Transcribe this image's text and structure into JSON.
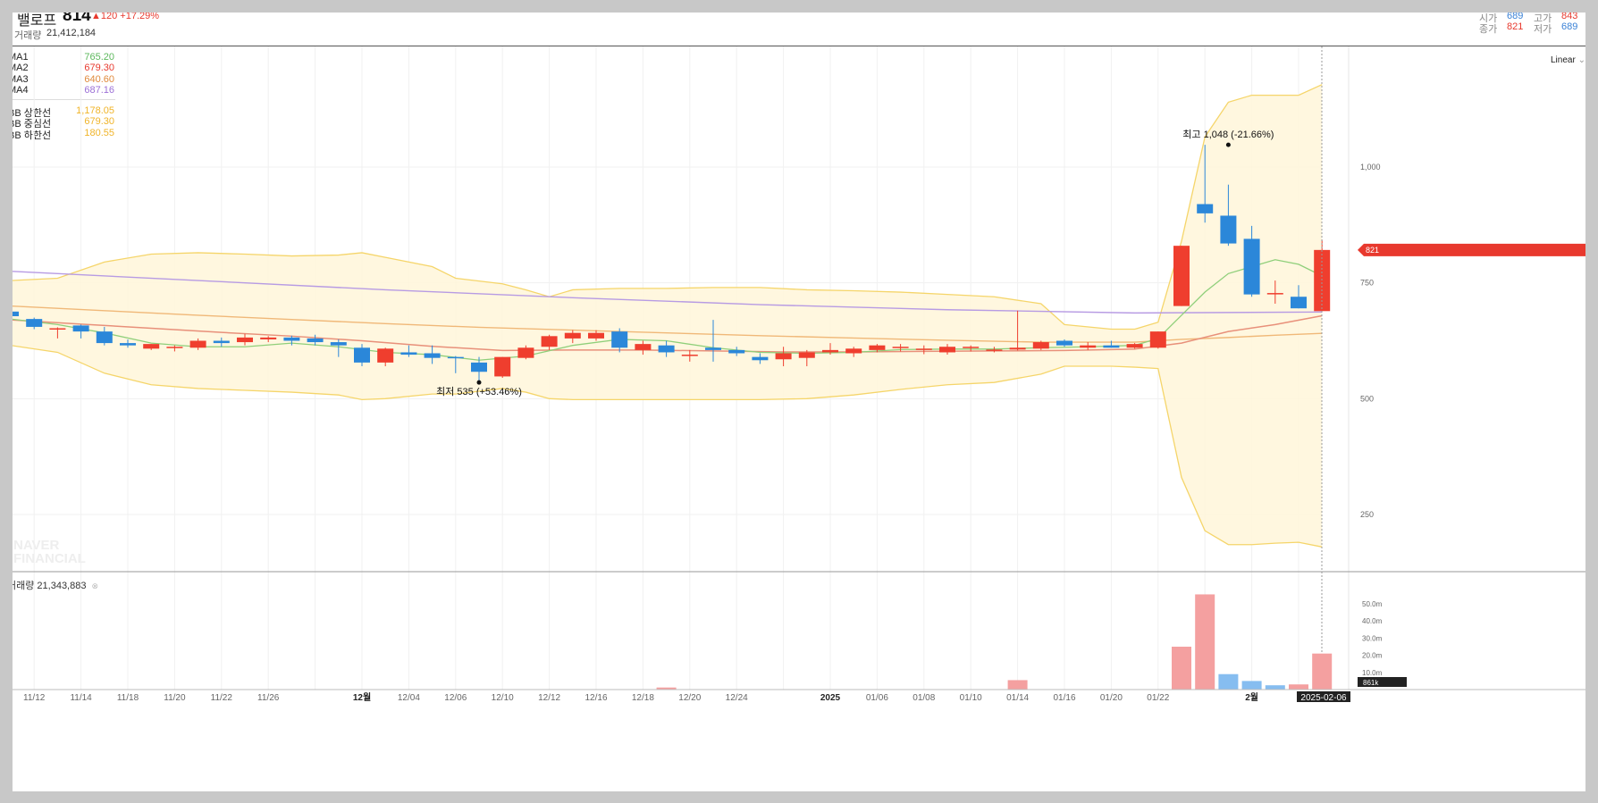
{
  "header": {
    "name": "밸로프",
    "price": "814",
    "change": "▲120 +17.29%",
    "volume_label": "거래량",
    "volume_value": "21,412,184",
    "ohlc": [
      {
        "label": "시가",
        "value": "689",
        "color": "#3b82d6"
      },
      {
        "label": "고가",
        "value": "843",
        "color": "#e8392e"
      },
      {
        "label": "종가",
        "value": "821",
        "color": "#e8392e"
      },
      {
        "label": "저가",
        "value": "689",
        "color": "#3b82d6"
      }
    ]
  },
  "legend": {
    "ma": [
      {
        "label": "MA1",
        "value": "765.20",
        "color": "#5cb85c"
      },
      {
        "label": "MA2",
        "value": "679.30",
        "color": "#e8392e"
      },
      {
        "label": "MA3",
        "value": "640.60",
        "color": "#e08a3c"
      },
      {
        "label": "MA4",
        "value": "687.16",
        "color": "#9b6fd6"
      }
    ],
    "bb": [
      {
        "label": "BB 상한선",
        "value": "1,178.05",
        "color": "#f0b429"
      },
      {
        "label": "BB 중심선",
        "value": "679.30",
        "color": "#f0b429"
      },
      {
        "label": "BB 하한선",
        "value": "180.55",
        "color": "#f0b429"
      }
    ]
  },
  "scale_label": "Linear",
  "watermark": [
    "NAVER",
    "FINANCIAL"
  ],
  "volume_panel": {
    "title": "거래량 21,343,883"
  },
  "current_date": "2025-02-06",
  "chart_data": {
    "type": "candlestick",
    "price_axis": {
      "ticks": [
        "250",
        "500",
        "750",
        "1,000"
      ],
      "ylim": [
        45,
        1165
      ]
    },
    "price_label": "821",
    "volume_axis": {
      "ticks": [
        "10.0m",
        "20.0m",
        "30.0m",
        "40.0m",
        "50.0m"
      ],
      "ylim": [
        0,
        57
      ]
    },
    "volume_label": "861k",
    "x_labels": [
      {
        "i": 1,
        "label": "11/12"
      },
      {
        "i": 3,
        "label": "11/14"
      },
      {
        "i": 5,
        "label": "11/18"
      },
      {
        "i": 7,
        "label": "11/20"
      },
      {
        "i": 9,
        "label": "11/22"
      },
      {
        "i": 11,
        "label": "11/26"
      },
      {
        "i": 15,
        "label": "12월"
      },
      {
        "i": 17,
        "label": "12/04"
      },
      {
        "i": 19,
        "label": "12/06"
      },
      {
        "i": 21,
        "label": "12/10"
      },
      {
        "i": 23,
        "label": "12/12"
      },
      {
        "i": 25,
        "label": "12/16"
      },
      {
        "i": 27,
        "label": "12/18"
      },
      {
        "i": 29,
        "label": "12/20"
      },
      {
        "i": 31,
        "label": "12/24"
      },
      {
        "i": 35,
        "label": "2025"
      },
      {
        "i": 37,
        "label": "01/06"
      },
      {
        "i": 39,
        "label": "01/08"
      },
      {
        "i": 41,
        "label": "01/10"
      },
      {
        "i": 43,
        "label": "01/14"
      },
      {
        "i": 45,
        "label": "01/16"
      },
      {
        "i": 47,
        "label": "01/20"
      },
      {
        "i": 49,
        "label": "01/22"
      },
      {
        "i": 53,
        "label": "2월"
      }
    ],
    "annotations": [
      {
        "text": "최고 1,048 (-21.66%)",
        "i": 52,
        "value": 1048,
        "pos": "above"
      },
      {
        "text": "최저 535 (+53.46%)",
        "i": 20,
        "value": 535,
        "pos": "below"
      }
    ],
    "candles": [
      [
        688,
        690,
        678,
        670
      ],
      [
        672,
        675,
        655,
        650
      ],
      [
        650,
        654,
        652,
        630
      ],
      [
        658,
        660,
        645,
        630
      ],
      [
        645,
        655,
        620,
        615
      ],
      [
        620,
        628,
        615,
        610
      ],
      [
        608,
        618,
        618,
        605
      ],
      [
        610,
        615,
        612,
        602
      ],
      [
        610,
        630,
        625,
        605
      ],
      [
        625,
        632,
        620,
        612
      ],
      [
        622,
        640,
        632,
        615
      ],
      [
        628,
        635,
        632,
        622
      ],
      [
        632,
        636,
        625,
        615
      ],
      [
        630,
        638,
        622,
        615
      ],
      [
        622,
        628,
        615,
        590
      ],
      [
        610,
        618,
        578,
        570
      ],
      [
        578,
        610,
        608,
        570
      ],
      [
        600,
        615,
        595,
        590
      ],
      [
        598,
        615,
        588,
        575
      ],
      [
        590,
        592,
        588,
        555
      ],
      [
        578,
        590,
        558,
        535
      ],
      [
        548,
        590,
        590,
        545
      ],
      [
        588,
        615,
        610,
        585
      ],
      [
        612,
        638,
        635,
        605
      ],
      [
        630,
        648,
        642,
        620
      ],
      [
        630,
        648,
        642,
        625
      ],
      [
        645,
        652,
        610,
        600
      ],
      [
        605,
        625,
        618,
        595
      ],
      [
        615,
        625,
        600,
        590
      ],
      [
        595,
        605,
        595,
        580
      ],
      [
        610,
        670,
        605,
        580
      ],
      [
        605,
        612,
        598,
        592
      ],
      [
        590,
        598,
        583,
        575
      ],
      [
        585,
        612,
        598,
        570
      ],
      [
        588,
        605,
        600,
        570
      ],
      [
        600,
        620,
        605,
        595
      ],
      [
        598,
        612,
        608,
        590
      ],
      [
        605,
        618,
        615,
        600
      ],
      [
        610,
        618,
        612,
        602
      ],
      [
        608,
        615,
        608,
        596
      ],
      [
        600,
        618,
        612,
        595
      ],
      [
        610,
        615,
        612,
        602
      ],
      [
        606,
        612,
        606,
        600
      ],
      [
        606,
        690,
        610,
        604
      ],
      [
        608,
        625,
        622,
        605
      ],
      [
        625,
        628,
        615,
        612
      ],
      [
        610,
        622,
        615,
        605
      ],
      [
        615,
        625,
        610,
        610
      ],
      [
        610,
        620,
        618,
        608
      ],
      [
        610,
        645,
        645,
        608
      ],
      [
        700,
        830,
        830,
        700
      ],
      [
        920,
        1048,
        900,
        880
      ],
      [
        895,
        962,
        835,
        830
      ],
      [
        845,
        873,
        725,
        720
      ],
      [
        728,
        755,
        728,
        705
      ],
      [
        720,
        745,
        695,
        695
      ],
      [
        689,
        843,
        821,
        689
      ]
    ],
    "ma1": [
      [
        0,
        672
      ],
      [
        2,
        660
      ],
      [
        4,
        642
      ],
      [
        6,
        620
      ],
      [
        8,
        612
      ],
      [
        10,
        612
      ],
      [
        12,
        620
      ],
      [
        14,
        612
      ],
      [
        16,
        600
      ],
      [
        18,
        595
      ],
      [
        20,
        583
      ],
      [
        22,
        592
      ],
      [
        24,
        615
      ],
      [
        26,
        628
      ],
      [
        28,
        625
      ],
      [
        30,
        610
      ],
      [
        32,
        600
      ],
      [
        34,
        598
      ],
      [
        36,
        600
      ],
      [
        38,
        606
      ],
      [
        40,
        607
      ],
      [
        42,
        607
      ],
      [
        44,
        610
      ],
      [
        46,
        612
      ],
      [
        48,
        615
      ],
      [
        49,
        630
      ],
      [
        50,
        680
      ],
      [
        51,
        730
      ],
      [
        52,
        770
      ],
      [
        54,
        800
      ],
      [
        55,
        790
      ],
      [
        56,
        765
      ]
    ],
    "ma2": [
      [
        0,
        670
      ],
      [
        3,
        661
      ],
      [
        6,
        652
      ],
      [
        9,
        643
      ],
      [
        12,
        635
      ],
      [
        15,
        625
      ],
      [
        18,
        613
      ],
      [
        21,
        604
      ],
      [
        24,
        605
      ],
      [
        27,
        605
      ],
      [
        30,
        603
      ],
      [
        33,
        601
      ],
      [
        36,
        601
      ],
      [
        39,
        602
      ],
      [
        42,
        603
      ],
      [
        45,
        604
      ],
      [
        48,
        607
      ],
      [
        50,
        620
      ],
      [
        52,
        645
      ],
      [
        54,
        660
      ],
      [
        56,
        679
      ]
    ],
    "ma3": [
      [
        0,
        700
      ],
      [
        4,
        690
      ],
      [
        8,
        680
      ],
      [
        12,
        671
      ],
      [
        16,
        662
      ],
      [
        20,
        654
      ],
      [
        24,
        648
      ],
      [
        28,
        642
      ],
      [
        32,
        636
      ],
      [
        36,
        631
      ],
      [
        40,
        626
      ],
      [
        44,
        622
      ],
      [
        48,
        622
      ],
      [
        50,
        628
      ],
      [
        52,
        632
      ],
      [
        54,
        637
      ],
      [
        56,
        641
      ]
    ],
    "ma4": [
      [
        0,
        775
      ],
      [
        8,
        755
      ],
      [
        16,
        735
      ],
      [
        24,
        718
      ],
      [
        32,
        703
      ],
      [
        40,
        692
      ],
      [
        48,
        685
      ],
      [
        56,
        687
      ]
    ],
    "bb_upper": [
      [
        0,
        755
      ],
      [
        2,
        760
      ],
      [
        4,
        795
      ],
      [
        6,
        812
      ],
      [
        8,
        815
      ],
      [
        10,
        812
      ],
      [
        12,
        808
      ],
      [
        14,
        810
      ],
      [
        15,
        815
      ],
      [
        16,
        805
      ],
      [
        18,
        785
      ],
      [
        19,
        760
      ],
      [
        21,
        748
      ],
      [
        22,
        735
      ],
      [
        23,
        720
      ],
      [
        24,
        735
      ],
      [
        26,
        738
      ],
      [
        28,
        738
      ],
      [
        30,
        740
      ],
      [
        32,
        740
      ],
      [
        34,
        735
      ],
      [
        36,
        733
      ],
      [
        38,
        730
      ],
      [
        40,
        725
      ],
      [
        42,
        720
      ],
      [
        44,
        705
      ],
      [
        45,
        660
      ],
      [
        47,
        650
      ],
      [
        48,
        650
      ],
      [
        49,
        665
      ],
      [
        50,
        840
      ],
      [
        51,
        1065
      ],
      [
        52,
        1140
      ],
      [
        53,
        1155
      ],
      [
        54,
        1155
      ],
      [
        55,
        1155
      ],
      [
        56,
        1178
      ]
    ],
    "bb_lower": [
      [
        0,
        615
      ],
      [
        2,
        600
      ],
      [
        4,
        555
      ],
      [
        6,
        530
      ],
      [
        8,
        522
      ],
      [
        10,
        518
      ],
      [
        12,
        514
      ],
      [
        14,
        508
      ],
      [
        15,
        498
      ],
      [
        16,
        500
      ],
      [
        18,
        510
      ],
      [
        19,
        510
      ],
      [
        21,
        522
      ],
      [
        22,
        514
      ],
      [
        23,
        500
      ],
      [
        24,
        498
      ],
      [
        26,
        498
      ],
      [
        28,
        498
      ],
      [
        30,
        498
      ],
      [
        32,
        498
      ],
      [
        34,
        500
      ],
      [
        36,
        508
      ],
      [
        38,
        520
      ],
      [
        40,
        530
      ],
      [
        42,
        535
      ],
      [
        44,
        553
      ],
      [
        45,
        570
      ],
      [
        47,
        570
      ],
      [
        48,
        568
      ],
      [
        49,
        565
      ],
      [
        50,
        330
      ],
      [
        51,
        215
      ],
      [
        52,
        185
      ],
      [
        53,
        185
      ],
      [
        54,
        188
      ],
      [
        55,
        190
      ],
      [
        56,
        180
      ]
    ],
    "volumes": [
      [
        28,
        1.2,
        "up"
      ],
      [
        43,
        5.5,
        "up"
      ],
      [
        50,
        25,
        "up"
      ],
      [
        51,
        55.5,
        "up"
      ],
      [
        52,
        9,
        "down"
      ],
      [
        53,
        5,
        "down"
      ],
      [
        54,
        2.5,
        "down"
      ],
      [
        55,
        3,
        "up"
      ],
      [
        56,
        21,
        "up"
      ]
    ]
  }
}
